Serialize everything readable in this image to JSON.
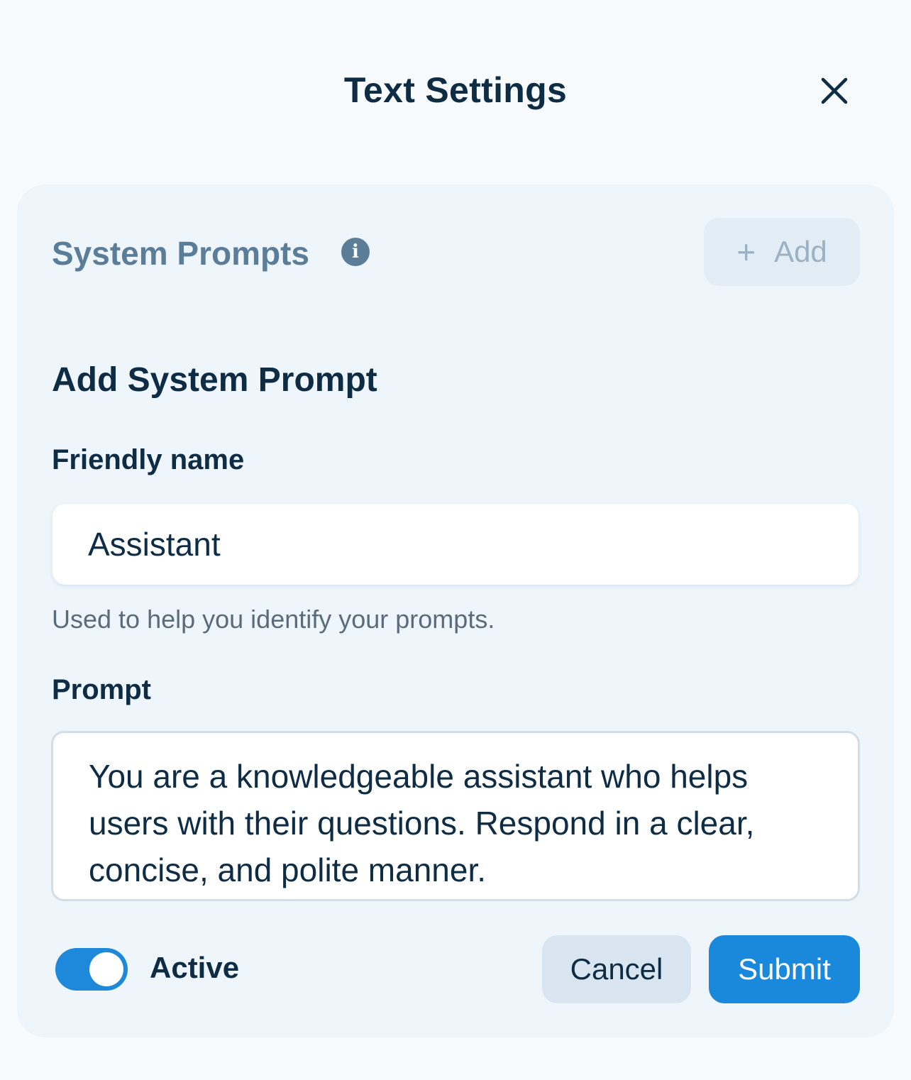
{
  "dialog": {
    "title": "Text Settings",
    "close_icon": "close-icon"
  },
  "system_prompts": {
    "title": "System Prompts",
    "info_icon": "info-icon",
    "info_glyph": "i",
    "add_icon": "plus-icon",
    "add_glyph": "+",
    "add_label": "Add"
  },
  "form": {
    "heading": "Add System Prompt",
    "friendly_name": {
      "label": "Friendly name",
      "value": "Assistant",
      "helper": "Used to help you identify your prompts."
    },
    "prompt": {
      "label": "Prompt",
      "value": "You are a knowledgeable assistant who helps users with their questions. Respond in a clear, concise, and polite manner."
    },
    "active": {
      "label": "Active",
      "on": true
    },
    "cancel_label": "Cancel",
    "submit_label": "Submit"
  },
  "colors": {
    "accent": "#1a89dc",
    "text": "#0f2c45",
    "muted_heading": "#5b7d98",
    "card_bg": "#eef6fc"
  }
}
